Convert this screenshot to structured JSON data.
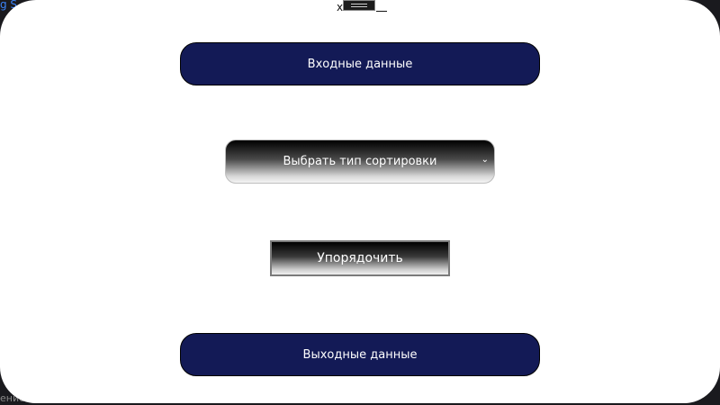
{
  "background": {
    "top_fragment": "g S",
    "bottom_fragment": "ение"
  },
  "window_controls": {
    "close_label": "x",
    "maximize_icon": "maximize-icon",
    "minimize_icon": "minimize-icon"
  },
  "buttons": {
    "input_data_label": "Входные данные",
    "sort_type_label": "Выбрать тип сортировки",
    "order_label": "Упорядочить",
    "output_data_label": "Выходные данные"
  },
  "colors": {
    "navy_button": "#131a56",
    "window_bg": "#ffffff",
    "desktop_bg": "#1a1a1e"
  }
}
